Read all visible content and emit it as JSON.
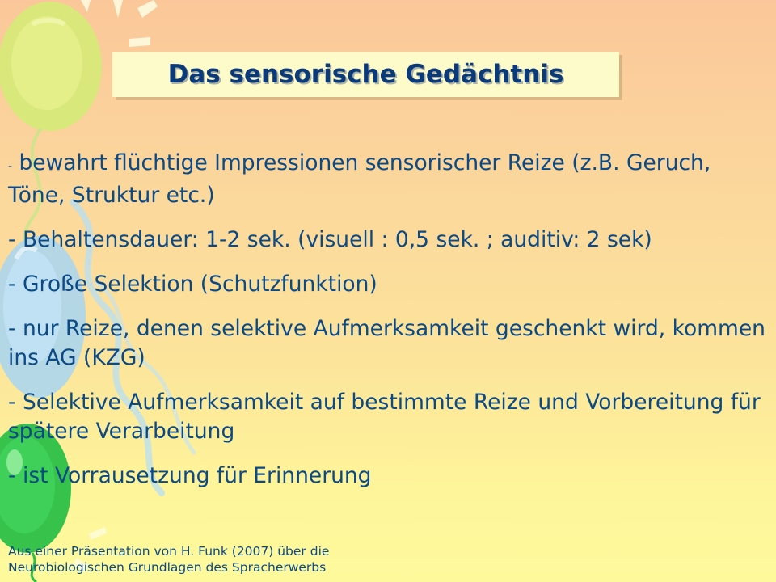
{
  "slide": {
    "title": "Das sensorische Gedächtnis",
    "bullets": [
      {
        "dash": "-",
        "text": " bewahrt flüchtige Impressionen sensorischer Reize (z.B. Geruch, Töne, Struktur etc.)"
      },
      {
        "dash": "",
        "text": "- Behaltensdauer: 1-2 sek. (visuell : 0,5 sek. ; auditiv: 2 sek)"
      },
      {
        "dash": "",
        "text": "- Große Selektion (Schutzfunktion)"
      },
      {
        "dash": "",
        "text": "- nur Reize, denen selektive Aufmerksamkeit geschenkt wird, kommen ins AG (KZG)"
      },
      {
        "dash": "",
        "text": "- Selektive Aufmerksamkeit auf bestimmte Reize und Vorbereitung für spätere Verarbeitung"
      },
      {
        "dash": "",
        "text": "- ist Vorrausetzung für Erinnerung"
      }
    ],
    "footer_line1": "Aus einer Präsentation von H. Funk (2007) über die",
    "footer_line2": "Neurobiologischen Grundlagen des Spracherwerbs"
  },
  "colors": {
    "title": "#0b3a7a",
    "text": "#0b4a86",
    "title_box": "#fdfbc9",
    "balloon_yellow_green": "#d8ec7a",
    "balloon_blue": "#a9d6f2",
    "balloon_green": "#2fc24a"
  },
  "decorations": [
    "balloon-yellow-green",
    "balloon-blue",
    "balloon-green",
    "balloon-strings",
    "starburst-rays"
  ]
}
